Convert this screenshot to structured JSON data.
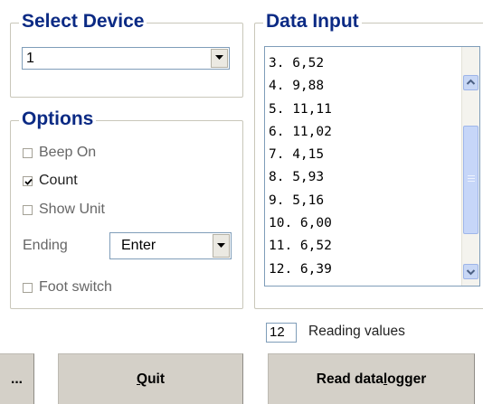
{
  "select_device": {
    "title": "Select Device",
    "value": "1"
  },
  "options": {
    "title": "Options",
    "beep_on": {
      "label": "Beep On",
      "checked": false
    },
    "count": {
      "label": "Count",
      "checked": true
    },
    "show_unit": {
      "label": "Show Unit",
      "checked": false
    },
    "ending": {
      "label": "Ending",
      "value": "Enter"
    },
    "foot_switch": {
      "label": "Foot switch",
      "checked": false
    }
  },
  "data_input": {
    "title": "Data Input",
    "lines": [
      "3. 6,52",
      "4. 9,88",
      "5. 11,11",
      "6. 11,02",
      "7. 4,15",
      "8. 5,93",
      "9. 5,16",
      "10. 6,00",
      "11. 6,52",
      "12. 6,39"
    ]
  },
  "reading": {
    "count": "12",
    "label": "Reading values"
  },
  "buttons": {
    "more": "...",
    "quit_mnemonic": "Q",
    "quit_rest": "uit",
    "read_pre": "Read data",
    "read_mnemonic": "l",
    "read_post": "ogger"
  },
  "colors": {
    "group_title": "#0b2a84",
    "button_face": "#d4d0c8",
    "field_border": "#7f9db9",
    "scroll_thumb": "#c6d6f8"
  }
}
